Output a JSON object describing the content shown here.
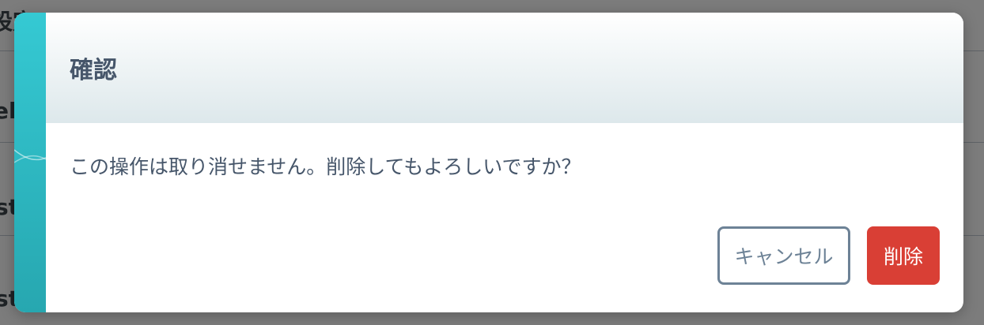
{
  "background": {
    "fragments": [
      "設定",
      "el",
      "st",
      "st"
    ]
  },
  "dialog": {
    "title": "確認",
    "message": "この操作は取り消せません。削除してもよろしいですか？",
    "cancel_label": "キャンセル",
    "delete_label": "削除"
  },
  "colors": {
    "accent": "#2fb8c2",
    "title_text": "#46566a",
    "cancel_border": "#6d8296",
    "delete_bg": "#d93f35"
  }
}
